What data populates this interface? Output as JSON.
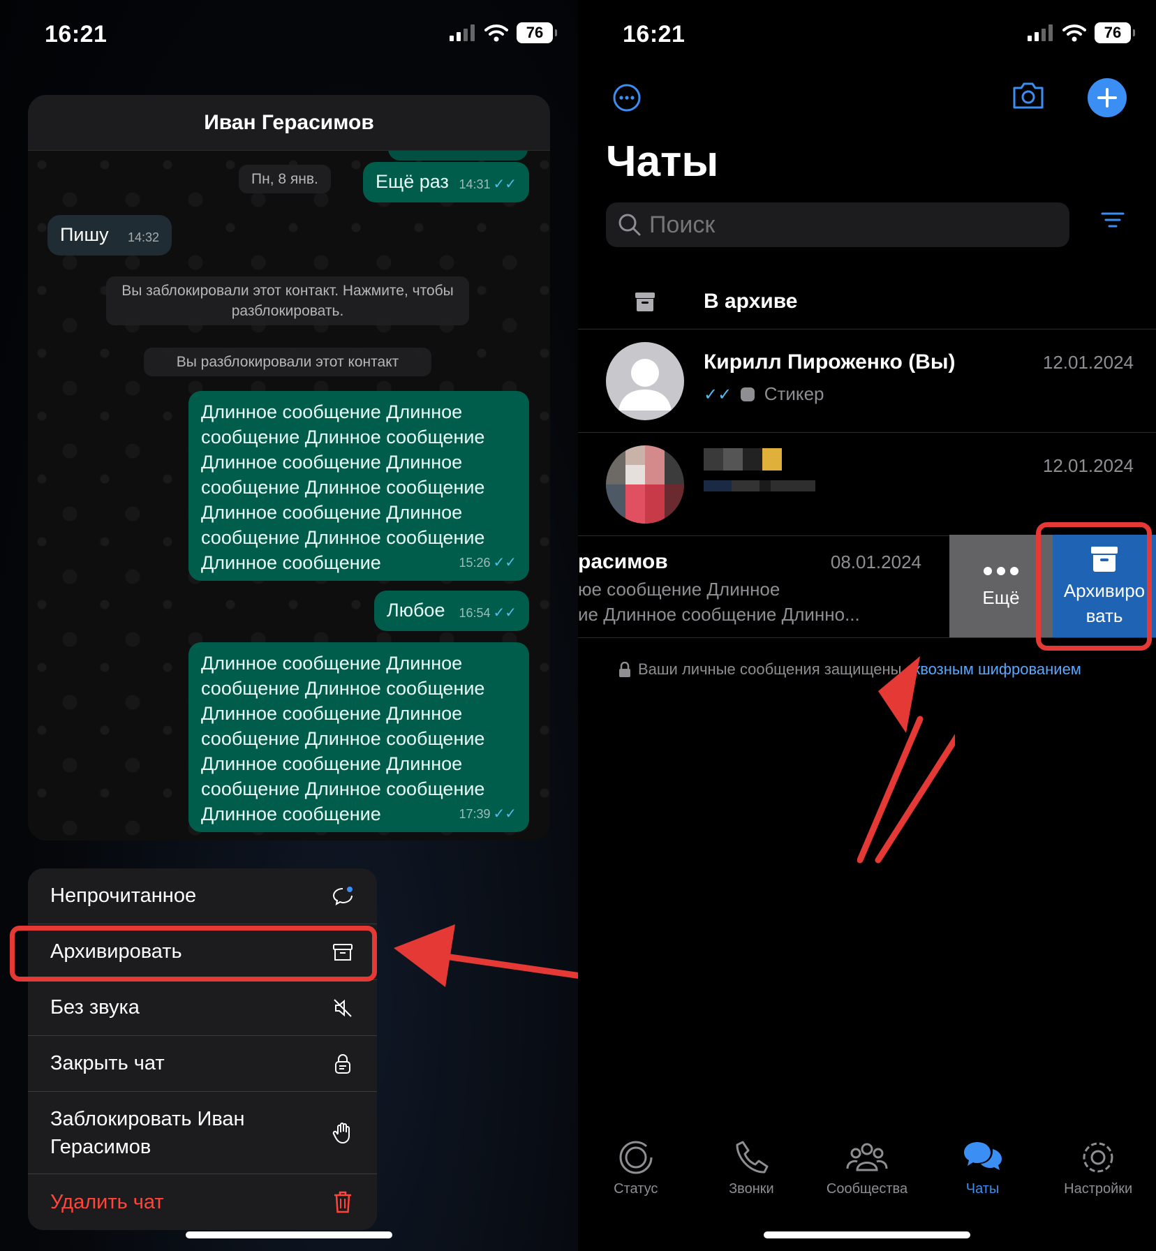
{
  "status": {
    "time": "16:21",
    "battery": "76"
  },
  "left": {
    "contact_name": "Иван Герасимов",
    "date_chip": "Пн, 8 янв.",
    "messages": [
      {
        "text": "Ещё раз",
        "time": "14:31"
      },
      {
        "text": "Пишу",
        "time": "14:32"
      },
      {
        "text": "Длинное сообщение Длинное сообщение Длинное сообщение Длинное сообщение Длинное сообщение Длинное сообщение Длинное сообщение Длинное сообщение Длинное сообщение Длинное сообщение",
        "time": "15:26"
      },
      {
        "text": "Любое",
        "time": "16:54"
      },
      {
        "text": "Длинное сообщение Длинное сообщение Длинное сообщение Длинное сообщение Длинное сообщение Длинное сообщение Длинное сообщение Длинное сообщение Длинное сообщение Длинное сообщение",
        "time": "17:39"
      }
    ],
    "system_blocked": "Вы заблокировали этот контакт. Нажмите, чтобы разблокировать.",
    "system_unblocked": "Вы разблокировали этот контакт",
    "menu": [
      {
        "label": "Непрочитанное",
        "icon": "unread-chat-icon"
      },
      {
        "label": "Архивировать",
        "icon": "archive-icon"
      },
      {
        "label": "Без звука",
        "icon": "mute-icon"
      },
      {
        "label": "Закрыть чат",
        "icon": "lock-chat-icon"
      },
      {
        "label": "Заблокировать Иван Герасимов",
        "icon": "hand-block-icon"
      },
      {
        "label": "Удалить чат",
        "icon": "trash-icon"
      }
    ]
  },
  "right": {
    "title": "Чаты",
    "search_placeholder": "Поиск",
    "archived_label": "В архиве",
    "chats": [
      {
        "name": "Кирилл Пироженко (Вы)",
        "message": "Стикер",
        "date": "12.01.2024"
      },
      {
        "name": "",
        "message": "",
        "date": "12.01.2024"
      },
      {
        "name": "расимов",
        "message_line1": "юе сообщение Длинное",
        "message_line2": "ие Длинное сообщение Длинно...",
        "date": "08.01.2024"
      }
    ],
    "swipe_more_label": "Ещё",
    "swipe_archive_label_1": "Архивиро",
    "swipe_archive_label_2": "вать",
    "encryption_text": "Ваши личные сообщения защищены ",
    "encryption_link": "сквозным шифрованием",
    "tabs": [
      {
        "label": "Статус",
        "icon": "status-icon",
        "active": false
      },
      {
        "label": "Звонки",
        "icon": "phone-icon",
        "active": false
      },
      {
        "label": "Сообщества",
        "icon": "communities-icon",
        "active": false
      },
      {
        "label": "Чаты",
        "icon": "chats-icon",
        "active": true
      },
      {
        "label": "Настройки",
        "icon": "settings-icon",
        "active": false
      }
    ]
  },
  "colors": {
    "accent": "#3b8ef3",
    "outgoing_bubble": "#005c4b",
    "highlight": "#e53935",
    "danger": "#ff453a",
    "archive_action": "#1f63b5"
  }
}
